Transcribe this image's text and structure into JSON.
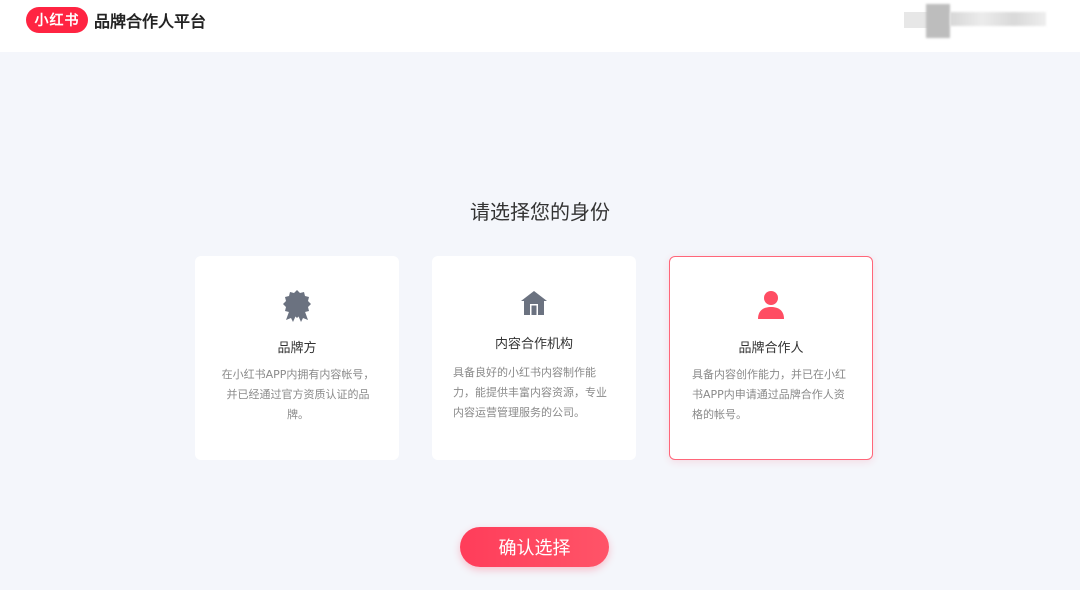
{
  "header": {
    "logo_text": "小红书",
    "title": "品牌合作人平台"
  },
  "main": {
    "heading": "请选择您的身份",
    "cards": [
      {
        "title": "品牌方",
        "description": "在小红书APP内拥有内容帐号，并已经通过官方资质认证的品牌。",
        "icon": "badge-icon",
        "selected": false
      },
      {
        "title": "内容合作机构",
        "description": "具备良好的小红书内容制作能力，能提供丰富内容资源，专业内容运营管理服务的公司。",
        "icon": "building-icon",
        "selected": false
      },
      {
        "title": "品牌合作人",
        "description": "具备内容创作能力，并已在小红书APP内申请通过品牌合作人资格的帐号。",
        "icon": "person-icon",
        "selected": true
      }
    ],
    "confirm_label": "确认选择"
  },
  "colors": {
    "accent": "#ff2442",
    "icon_gray": "#6b7280",
    "background": "#f4f6fb"
  }
}
